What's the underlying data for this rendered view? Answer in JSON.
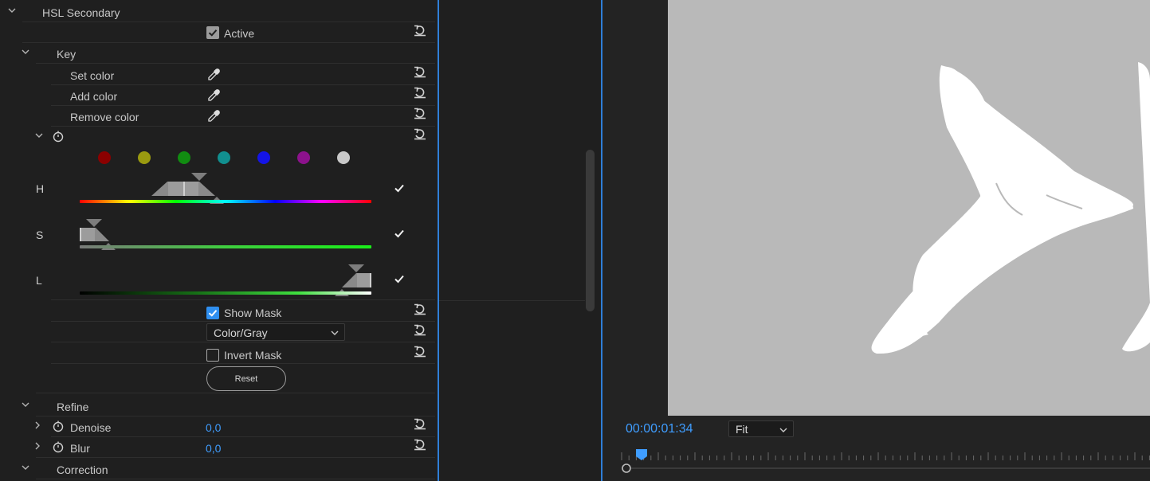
{
  "effect_controls": {
    "section_title": "HSL Secondary",
    "active_label": "Active",
    "key_title": "Key",
    "set_color": "Set color",
    "add_color": "Add color",
    "remove_color": "Remove color",
    "swatches": [
      "#8b0000",
      "#9a9a10",
      "#118c11",
      "#118f8f",
      "#1414e6",
      "#8c128c",
      "#c8c8c8"
    ],
    "channels": {
      "h": {
        "label": "H",
        "start": 0.25,
        "end": 0.4,
        "enabled": true
      },
      "s": {
        "label": "S",
        "start": 0.0,
        "end": 0.1,
        "enabled": true
      },
      "l": {
        "label": "L",
        "start": 0.9,
        "end": 1.0,
        "enabled": true
      }
    },
    "show_mask_label": "Show Mask",
    "show_mask_checked": true,
    "mask_mode": "Color/Gray",
    "invert_mask_label": "Invert Mask",
    "invert_mask_checked": false,
    "reset_button": "Reset",
    "refine_title": "Refine",
    "denoise_label": "Denoise",
    "denoise_value": "0,0",
    "blur_label": "Blur",
    "blur_value": "0,0",
    "correction_title": "Correction"
  },
  "monitor": {
    "timecode": "00:00:01:34",
    "zoom": "Fit"
  },
  "colors": {
    "accent": "#3f9dff",
    "divider": "#2f7fd8",
    "panel_bg": "#1f1f1f"
  }
}
